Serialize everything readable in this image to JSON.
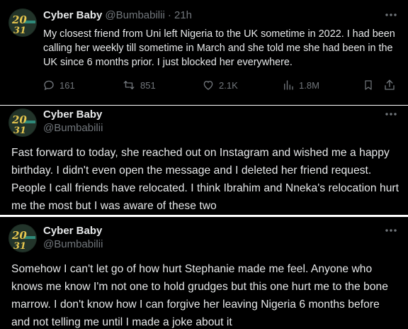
{
  "colors": {
    "background": "#000000",
    "text": "#e7e9ea",
    "muted": "#71767b",
    "avatar_bg": "#1e2d24",
    "avatar_gold": "#e7c74f"
  },
  "tweets": [
    {
      "author": {
        "name": "Cyber Baby",
        "handle": "@Bumbabilii",
        "time": "· 21h",
        "avatar_text": "20",
        "avatar_subtext": "31"
      },
      "text": "My closest friend from Uni left Nigeria to the UK sometime in 2022. I had been calling her weekly till sometime in March and she told me she had been in the UK since 6 months prior. I just blocked her everywhere.",
      "actions": {
        "replies": {
          "icon": "reply-icon",
          "count": "161"
        },
        "reposts": {
          "icon": "repost-icon",
          "count": "851"
        },
        "likes": {
          "icon": "like-icon",
          "count": "2.1K"
        },
        "views": {
          "icon": "views-icon",
          "count": "1.8M"
        },
        "bookmark": {
          "icon": "bookmark-icon"
        },
        "share": {
          "icon": "share-icon"
        }
      }
    },
    {
      "author": {
        "name": "Cyber Baby",
        "handle": "@Bumbabilii",
        "avatar_text": "20",
        "avatar_subtext": "31"
      },
      "text": "Fast forward to today, she reached out on Instagram and wished me a happy birthday. I didn't even open the message and I deleted her friend request. People I call friends have relocated. I think Ibrahim and Nneka's relocation hurt me the most but I was aware of these two"
    },
    {
      "author": {
        "name": "Cyber Baby",
        "handle": "@Bumbabilii",
        "avatar_text": "20",
        "avatar_subtext": "31"
      },
      "text": "Somehow I can't let go of how hurt Stephanie made me feel. Anyone who knows me know I'm not one to hold grudges but this one hurt me to the bone marrow. I don't know how I can forgive her leaving Nigeria 6 months before and not telling me until I made a joke about it"
    }
  ]
}
